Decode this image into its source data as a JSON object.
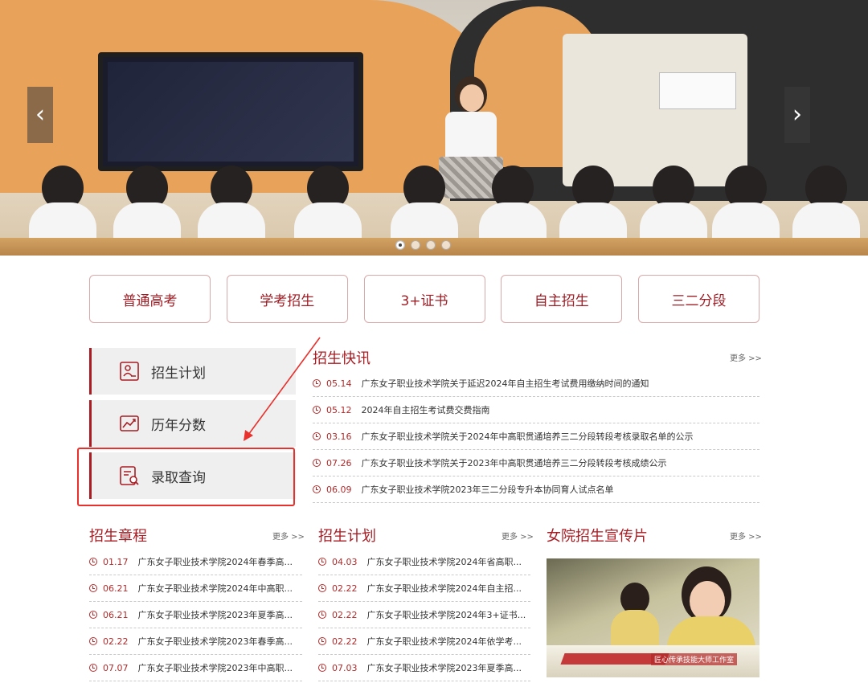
{
  "banner": {
    "prev_label": "‹",
    "next_label": "›",
    "slides": [
      {
        "active": true
      },
      {
        "active": false
      },
      {
        "active": false
      },
      {
        "active": false
      }
    ]
  },
  "categories": [
    "普通高考",
    "学考招生",
    "3+证书",
    "自主招生",
    "三二分段"
  ],
  "side_menu": [
    {
      "label": "招生计划",
      "icon": "plan-icon"
    },
    {
      "label": "历年分数",
      "icon": "chart-icon"
    },
    {
      "label": "录取查询",
      "icon": "search-doc-icon"
    }
  ],
  "news": {
    "title": "招生快讯",
    "more": "更多 >>",
    "items": [
      {
        "date": "05.14",
        "title": "广东女子职业技术学院关于延迟2024年自主招生考试费用缴纳时间的通知"
      },
      {
        "date": "05.12",
        "title": "2024年自主招生考试费交费指南"
      },
      {
        "date": "03.16",
        "title": "广东女子职业技术学院关于2024年中高职贯通培养三二分段转段考核录取名单的公示"
      },
      {
        "date": "07.26",
        "title": "广东女子职业技术学院关于2023年中高职贯通培养三二分段转段考核成绩公示"
      },
      {
        "date": "06.09",
        "title": "广东女子职业技术学院2023年三二分段专升本协同育人试点名单"
      }
    ]
  },
  "charter": {
    "title": "招生章程",
    "more": "更多 >>",
    "items": [
      {
        "date": "01.17",
        "title": "广东女子职业技术学院2024年春季高..."
      },
      {
        "date": "06.21",
        "title": "广东女子职业技术学院2024年中高职..."
      },
      {
        "date": "06.21",
        "title": "广东女子职业技术学院2023年夏季高..."
      },
      {
        "date": "02.22",
        "title": "广东女子职业技术学院2023年春季高..."
      },
      {
        "date": "07.07",
        "title": "广东女子职业技术学院2023年中高职..."
      }
    ]
  },
  "plan": {
    "title": "招生计划",
    "more": "更多 >>",
    "items": [
      {
        "date": "04.03",
        "title": "广东女子职业技术学院2024年省高职..."
      },
      {
        "date": "02.22",
        "title": "广东女子职业技术学院2024年自主招..."
      },
      {
        "date": "02.22",
        "title": "广东女子职业技术学院2024年3+证书..."
      },
      {
        "date": "02.22",
        "title": "广东女子职业技术学院2024年依学考..."
      },
      {
        "date": "07.03",
        "title": "广东女子职业技术学院2023年夏季高..."
      }
    ]
  },
  "promo": {
    "title": "女院招生宣传片",
    "more": "更多 >>",
    "caption": "匠心传承技能大师工作室"
  },
  "colors": {
    "accent": "#a81d23",
    "highlight": "#e8302c"
  }
}
